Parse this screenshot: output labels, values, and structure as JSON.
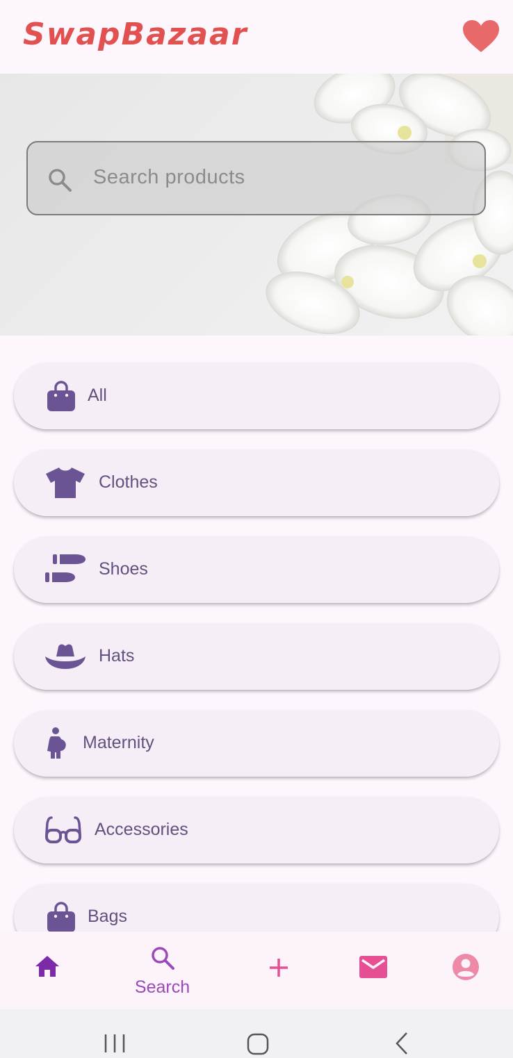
{
  "app": {
    "title": "SwapBazaar"
  },
  "header": {
    "favorites_icon": "heart-icon",
    "accent": "#e0514f"
  },
  "search": {
    "placeholder": "Search products",
    "icon": "search-icon"
  },
  "categories": [
    {
      "label": "All",
      "icon": "shopping-bag-icon"
    },
    {
      "label": "Clothes",
      "icon": "tshirt-icon"
    },
    {
      "label": "Shoes",
      "icon": "shoe-prints-icon"
    },
    {
      "label": "Hats",
      "icon": "hat-icon"
    },
    {
      "label": "Maternity",
      "icon": "pregnant-woman-icon"
    },
    {
      "label": "Accessories",
      "icon": "glasses-icon"
    },
    {
      "label": "Bags",
      "icon": "shopping-bag-icon"
    }
  ],
  "bottom_nav": [
    {
      "icon": "home-icon",
      "label": ""
    },
    {
      "icon": "search-icon",
      "label": "Search"
    },
    {
      "icon": "add-icon",
      "label": ""
    },
    {
      "icon": "mail-icon",
      "label": ""
    },
    {
      "icon": "account-icon",
      "label": ""
    }
  ],
  "colors": {
    "category_text": "#62507e",
    "nav_active": "#9b49b9",
    "nav_pink": "#e64f94"
  }
}
